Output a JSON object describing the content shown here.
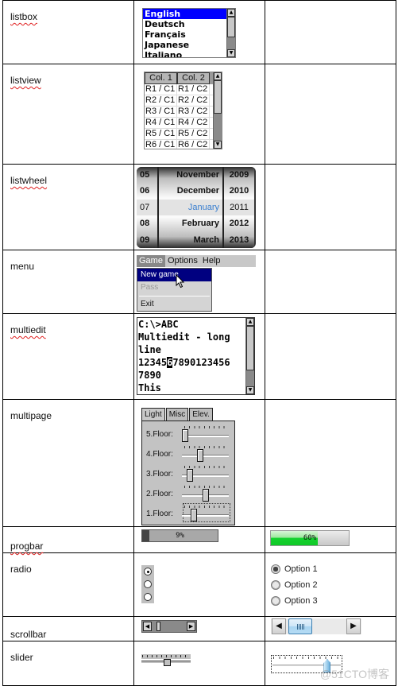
{
  "rows": {
    "listbox": {
      "label": "listbox",
      "items": [
        "English",
        "Deutsch",
        "Français",
        "Japanese",
        "Italiano"
      ],
      "selected": "English"
    },
    "listview": {
      "label": "listview",
      "columns": [
        "Col. 1",
        "Col. 2"
      ],
      "rows": [
        [
          "R1 / C1",
          "R1 / C2"
        ],
        [
          "R2 / C1",
          "R2 / C2"
        ],
        [
          "R3 / C1",
          "R3 / C2"
        ],
        [
          "R4 / C1",
          "R4 / C2"
        ],
        [
          "R5 / C1",
          "R5 / C2"
        ],
        [
          "R6 / C1",
          "R6 / C2"
        ]
      ]
    },
    "listwheel": {
      "label": "listwheel",
      "days": [
        "05",
        "06",
        "07",
        "08",
        "09"
      ],
      "months": [
        "November",
        "December",
        "January",
        "February",
        "March"
      ],
      "years": [
        "2009",
        "2010",
        "2011",
        "2012",
        "2013"
      ],
      "selected_index": 2
    },
    "menu": {
      "label": "menu",
      "bar": [
        "Game",
        "Options",
        "Help"
      ],
      "active": "Game",
      "items": [
        {
          "label": "New game",
          "state": "highlighted"
        },
        {
          "label": "Pass",
          "state": "disabled"
        },
        {
          "label": "Exit",
          "state": "normal"
        }
      ]
    },
    "multiedit": {
      "label": "multiedit",
      "lines": [
        "C:\\>ABC",
        "Multiedit - long",
        "line",
        "12345",
        "6",
        "7890123456",
        "7890",
        "This"
      ]
    },
    "multipage": {
      "label": "multipage",
      "tabs": [
        "Light",
        "Misc",
        "Elev."
      ],
      "active_tab": "Light",
      "floors": [
        {
          "label": "5.Floor:",
          "value": 0.0
        },
        {
          "label": "4.Floor:",
          "value": 0.38
        },
        {
          "label": "3.Floor:",
          "value": 0.12
        },
        {
          "label": "2.Floor:",
          "value": 0.52
        },
        {
          "label": "1.Floor:",
          "value": 0.22,
          "focused": true
        }
      ]
    },
    "progbar": {
      "label": "progbar",
      "classic": {
        "value": 9,
        "text": "9%"
      },
      "skinned": {
        "value": 60,
        "text": "60%"
      }
    },
    "radio": {
      "label": "radio",
      "classic_selected": 0,
      "options": [
        "Option 1",
        "Option 2",
        "Option 3"
      ],
      "skinned_selected": 0
    },
    "scrollbar": {
      "label": "scrollbar",
      "left_arrow": "◀",
      "right_arrow": "▶"
    },
    "slider": {
      "label": "slider",
      "classic_value": 0.55,
      "skinned_value": 0.85
    }
  },
  "watermark": "@51CTO博客"
}
